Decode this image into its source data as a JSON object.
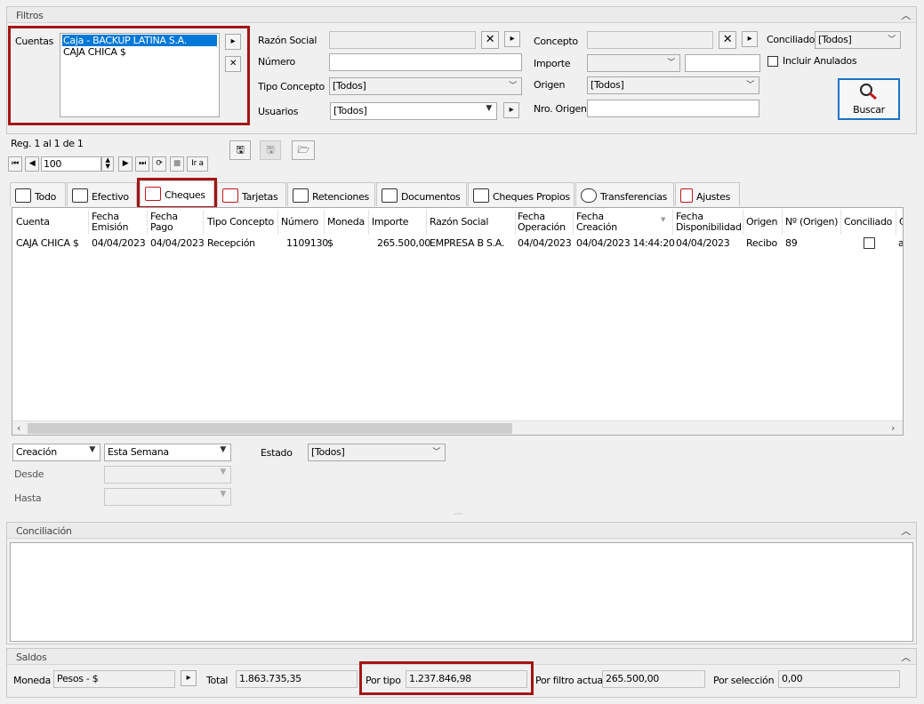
{
  "filtros": {
    "title": "Filtros",
    "cuentas_label": "Cuentas",
    "cuentas": [
      "Caja - BACKUP LATINA S.A.",
      "CAJA CHICA $"
    ],
    "razon_social_label": "Razón Social",
    "numero_label": "Número",
    "tipo_concepto_label": "Tipo Concepto",
    "tipo_concepto_value": "[Todos]",
    "usuarios_label": "Usuarios",
    "usuarios_value": "[Todos]",
    "concepto_label": "Concepto",
    "importe_label": "Importe",
    "origen_label": "Origen",
    "origen_value": "[Todos]",
    "nro_origen_label": "Nro. Origen",
    "conciliado_label": "Conciliado",
    "conciliado_value": "[Todos]",
    "incluir_anulados_label": "Incluir Anulados",
    "buscar_label": "Buscar"
  },
  "nav": {
    "reg_text": "Reg. 1 al 1 de 1",
    "page_size": "100",
    "ira_label": "Ir a"
  },
  "tabs": [
    "Todo",
    "Efectivo",
    "Cheques",
    "Tarjetas",
    "Retenciones",
    "Documentos",
    "Cheques Propios",
    "Transferencias",
    "Ajustes"
  ],
  "grid": {
    "headers": [
      "Cuenta",
      "Fecha\nEmisión",
      "Fecha\nPago",
      "Tipo Concepto",
      "Número",
      "Moneda",
      "Importe",
      "Razón Social",
      "Fecha\nOperación",
      "Fecha\nCreación",
      "Fecha\nDisponibilidad",
      "Origen",
      "Nº (Origen)",
      "Conciliado",
      "C"
    ],
    "row": {
      "cuenta": "CAJA CHICA $",
      "emision": "04/04/2023",
      "pago": "04/04/2023",
      "tipo": "Recepción",
      "numero": "1109130",
      "moneda": "$",
      "importe": "265.500,00",
      "razon": "EMPRESA B S.A.",
      "operacion": "04/04/2023",
      "creacion": "04/04/2023 14:44:20",
      "disponibilidad": "04/04/2023",
      "origen": "Recibo",
      "nro_origen": "89",
      "extra": "a"
    }
  },
  "date_filter": {
    "field": "Creación",
    "range": "Esta Semana",
    "desde_label": "Desde",
    "hasta_label": "Hasta",
    "estado_label": "Estado",
    "estado_value": "[Todos]"
  },
  "conciliacion": {
    "title": "Conciliación"
  },
  "saldos": {
    "title": "Saldos",
    "moneda_label": "Moneda",
    "moneda_value": "Pesos - $",
    "total_label": "Total",
    "total_value": "1.863.735,35",
    "por_tipo_label": "Por tipo",
    "por_tipo_value": "1.237.846,98",
    "por_filtro_label": "Por filtro actual",
    "por_filtro_value": "265.500,00",
    "por_seleccion_label": "Por selección",
    "por_seleccion_value": "0,00"
  }
}
